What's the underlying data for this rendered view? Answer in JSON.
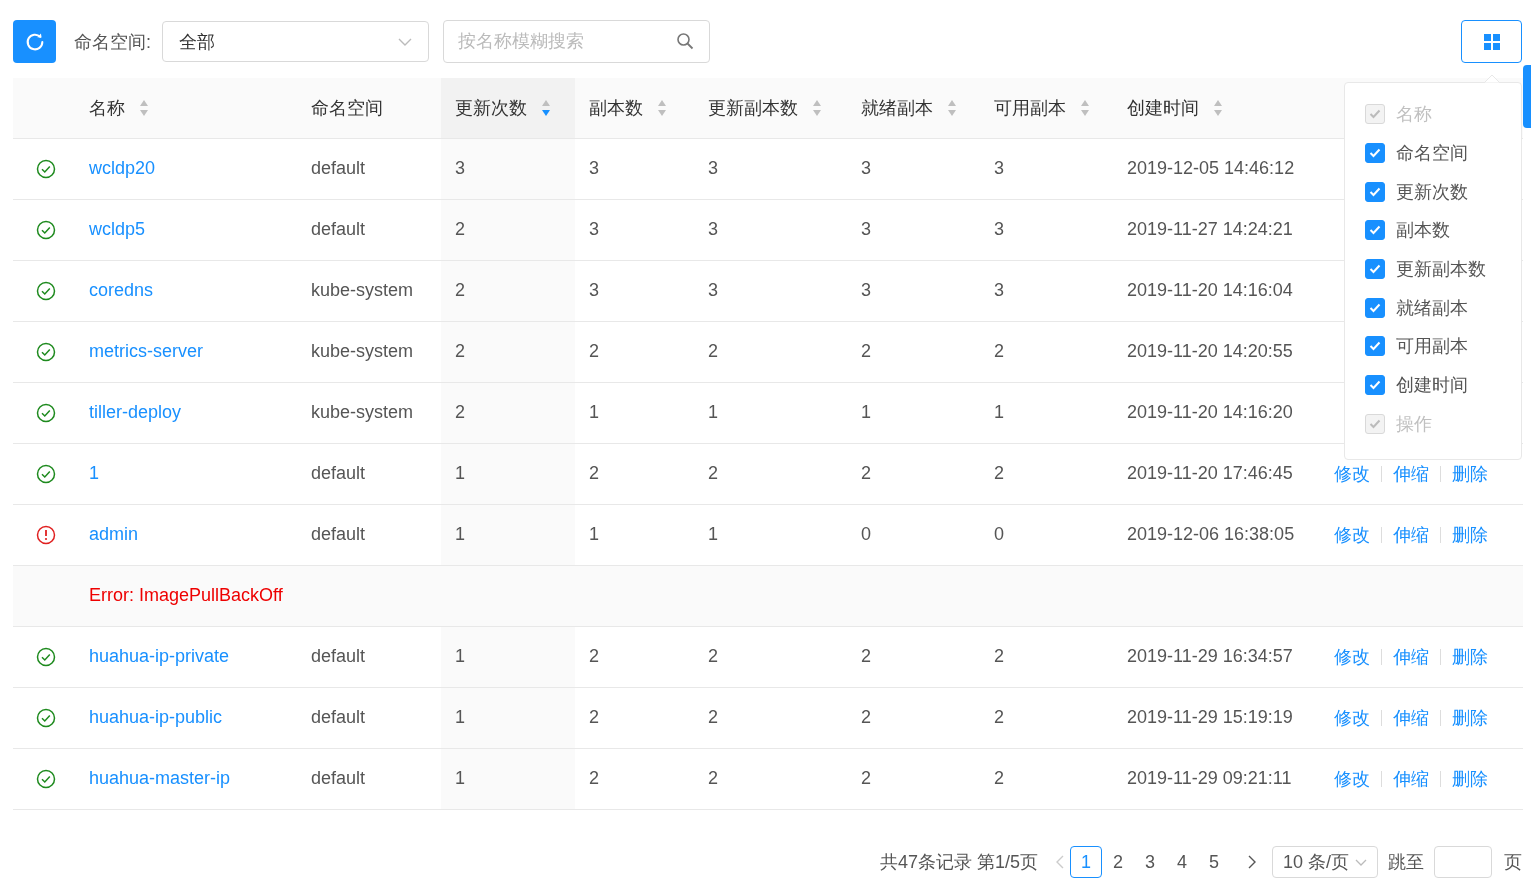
{
  "toolbar": {
    "namespace_label": "命名空间:",
    "namespace_value": "全部",
    "search": {
      "placeholder": "按名称模糊搜索"
    }
  },
  "table": {
    "columns": [
      {
        "label": "名称",
        "sortable": true,
        "sort_desc": false
      },
      {
        "label": "命名空间",
        "sortable": false
      },
      {
        "label": "更新次数",
        "sortable": true,
        "sort_desc": true
      },
      {
        "label": "副本数",
        "sortable": true,
        "sort_desc": false
      },
      {
        "label": "更新副本数",
        "sortable": true,
        "sort_desc": false
      },
      {
        "label": "就绪副本",
        "sortable": true,
        "sort_desc": false
      },
      {
        "label": "可用副本",
        "sortable": true,
        "sort_desc": false
      },
      {
        "label": "创建时间",
        "sortable": true,
        "sort_desc": false
      }
    ],
    "rows": [
      {
        "kind": "data",
        "error": false,
        "name": "wcldp20",
        "namespace": "default",
        "updates": "3",
        "replicas": "3",
        "updated_replicas": "3",
        "ready": "3",
        "available": "3",
        "created": "2019-12-05 14:46:12"
      },
      {
        "kind": "data",
        "error": false,
        "name": "wcldp5",
        "namespace": "default",
        "updates": "2",
        "replicas": "3",
        "updated_replicas": "3",
        "ready": "3",
        "available": "3",
        "created": "2019-11-27 14:24:21"
      },
      {
        "kind": "data",
        "error": false,
        "name": "coredns",
        "namespace": "kube-system",
        "updates": "2",
        "replicas": "3",
        "updated_replicas": "3",
        "ready": "3",
        "available": "3",
        "created": "2019-11-20 14:16:04"
      },
      {
        "kind": "data",
        "error": false,
        "name": "metrics-server",
        "namespace": "kube-system",
        "updates": "2",
        "replicas": "2",
        "updated_replicas": "2",
        "ready": "2",
        "available": "2",
        "created": "2019-11-20 14:20:55"
      },
      {
        "kind": "data",
        "error": false,
        "name": "tiller-deploy",
        "namespace": "kube-system",
        "updates": "2",
        "replicas": "1",
        "updated_replicas": "1",
        "ready": "1",
        "available": "1",
        "created": "2019-11-20 14:16:20"
      },
      {
        "kind": "data",
        "error": false,
        "name": "1",
        "namespace": "default",
        "updates": "1",
        "replicas": "2",
        "updated_replicas": "2",
        "ready": "2",
        "available": "2",
        "created": "2019-11-20 17:46:45",
        "actions": [
          {
            "label": "修改",
            "disabled": false
          },
          {
            "label": "伸缩",
            "disabled": false
          },
          {
            "label": "删除",
            "disabled": false
          }
        ]
      },
      {
        "kind": "data",
        "error": true,
        "name": "admin",
        "namespace": "default",
        "updates": "1",
        "replicas": "1",
        "updated_replicas": "1",
        "ready": "0",
        "available": "0",
        "created": "2019-12-06 16:38:05",
        "actions": [
          {
            "label": "修改",
            "disabled": false
          },
          {
            "label": "伸缩",
            "disabled": false
          },
          {
            "label": "删除",
            "disabled": false
          }
        ]
      },
      {
        "kind": "error",
        "message": "Error: ImagePullBackOff"
      },
      {
        "kind": "data",
        "error": false,
        "name": "huahua-ip-private",
        "namespace": "default",
        "updates": "1",
        "replicas": "2",
        "updated_replicas": "2",
        "ready": "2",
        "available": "2",
        "created": "2019-11-29 16:34:57",
        "actions": [
          {
            "label": "修改",
            "disabled": false
          },
          {
            "label": "伸缩",
            "disabled": false
          },
          {
            "label": "删除",
            "disabled": false
          }
        ]
      },
      {
        "kind": "data",
        "error": false,
        "name": "huahua-ip-public",
        "namespace": "default",
        "updates": "1",
        "replicas": "2",
        "updated_replicas": "2",
        "ready": "2",
        "available": "2",
        "created": "2019-11-29 15:19:19",
        "actions": [
          {
            "label": "修改",
            "disabled": false
          },
          {
            "label": "伸缩",
            "disabled": false
          },
          {
            "label": "删除",
            "disabled": false
          }
        ]
      },
      {
        "kind": "data",
        "error": false,
        "name": "huahua-master-ip",
        "namespace": "default",
        "updates": "1",
        "replicas": "2",
        "updated_replicas": "2",
        "ready": "2",
        "available": "2",
        "created": "2019-11-29 09:21:11",
        "actions": [
          {
            "label": "修改",
            "disabled": false
          },
          {
            "label": "伸缩",
            "disabled": false
          },
          {
            "label": "删除",
            "disabled": false
          }
        ]
      }
    ]
  },
  "column_menu": {
    "items": [
      {
        "label": "名称",
        "checked": true,
        "disabled": true
      },
      {
        "label": "命名空间",
        "checked": true,
        "disabled": false
      },
      {
        "label": "更新次数",
        "checked": true,
        "disabled": false
      },
      {
        "label": "副本数",
        "checked": true,
        "disabled": false
      },
      {
        "label": "更新副本数",
        "checked": true,
        "disabled": false
      },
      {
        "label": "就绪副本",
        "checked": true,
        "disabled": false
      },
      {
        "label": "可用副本",
        "checked": true,
        "disabled": false
      },
      {
        "label": "创建时间",
        "checked": true,
        "disabled": false
      },
      {
        "label": "操作",
        "checked": true,
        "disabled": true
      }
    ]
  },
  "pagination": {
    "summary": "共47条记录 第1/5页",
    "prev_disabled": true,
    "pages": [
      {
        "label": "1",
        "selected": true
      },
      {
        "label": "2",
        "selected": false
      },
      {
        "label": "3",
        "selected": false
      },
      {
        "label": "4",
        "selected": false
      },
      {
        "label": "5",
        "selected": false
      }
    ],
    "page_size": "10 条/页",
    "jump_label": "跳至",
    "jump_suffix": "页"
  }
}
